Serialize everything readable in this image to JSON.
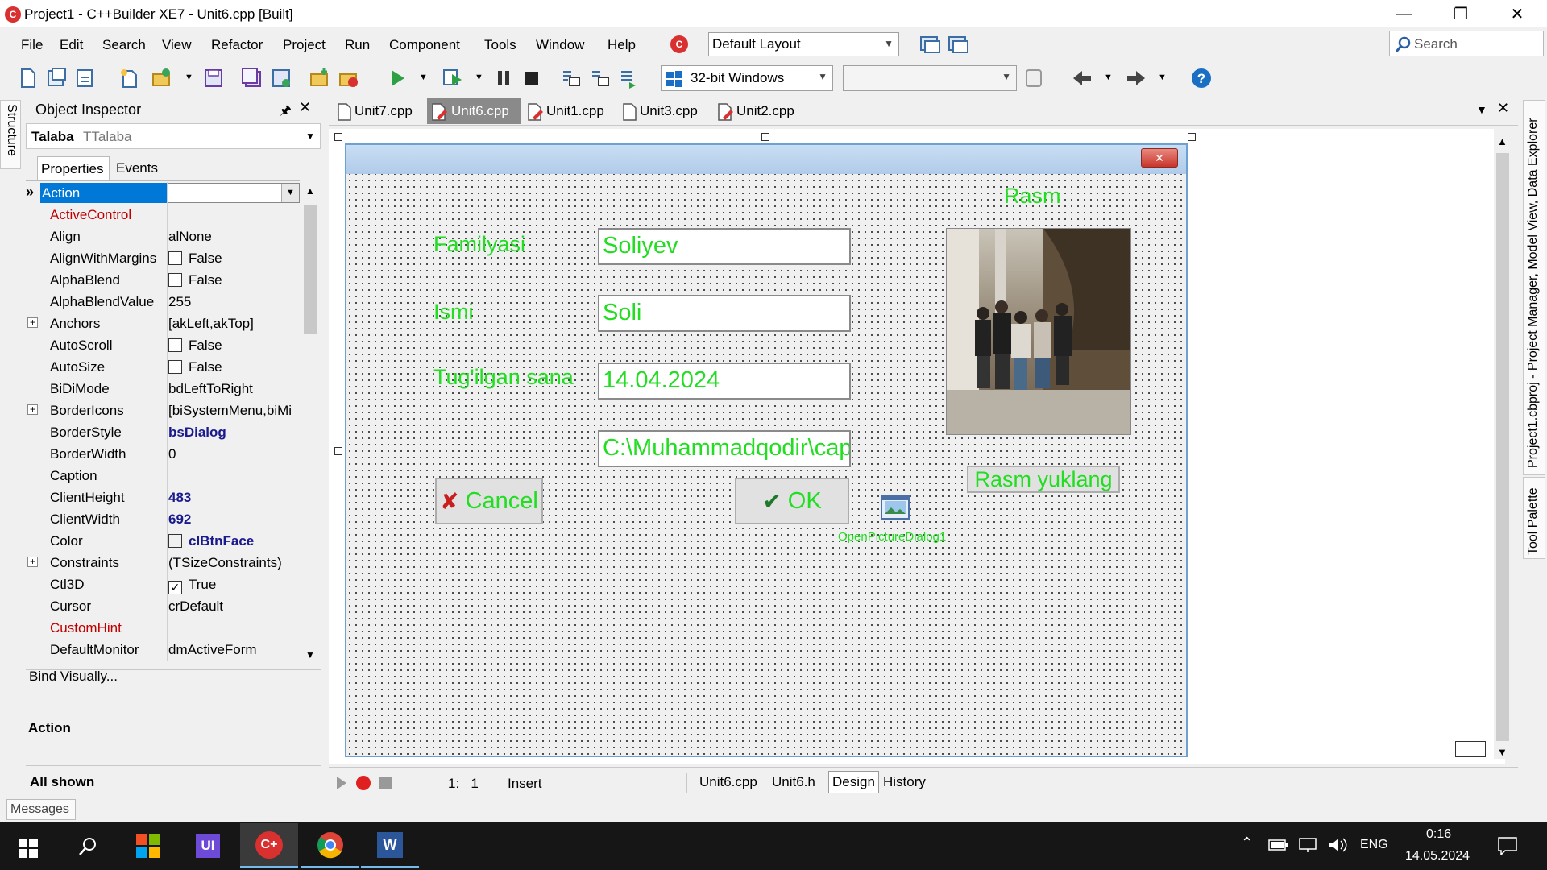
{
  "window": {
    "title": "Project1 - C++Builder XE7 - Unit6.cpp [Built]",
    "app_icon": "C"
  },
  "menu": [
    "File",
    "Edit",
    "Search",
    "View",
    "Refactor",
    "Project",
    "Run",
    "Component",
    "Tools",
    "Window",
    "Help"
  ],
  "toolbar": {
    "layout": "Default Layout",
    "search_placeholder": "Search",
    "platform": "32-bit Windows"
  },
  "structure_tab": "Structure",
  "object_inspector": {
    "title": "Object Inspector",
    "object_name": "Talaba",
    "object_type": "TTalaba",
    "tabs": [
      "Properties",
      "Events"
    ],
    "properties": [
      {
        "name": "Action",
        "value": "",
        "selected": true
      },
      {
        "name": "ActiveControl",
        "value": "",
        "color": "#c00000"
      },
      {
        "name": "Align",
        "value": "alNone"
      },
      {
        "name": "AlignWithMargins",
        "value": "False",
        "checkbox": true
      },
      {
        "name": "AlphaBlend",
        "value": "False",
        "checkbox": true
      },
      {
        "name": "AlphaBlendValue",
        "value": "255"
      },
      {
        "name": "Anchors",
        "value": "[akLeft,akTop]",
        "expand": true
      },
      {
        "name": "AutoScroll",
        "value": "False",
        "checkbox": true
      },
      {
        "name": "AutoSize",
        "value": "False",
        "checkbox": true
      },
      {
        "name": "BiDiMode",
        "value": "bdLeftToRight"
      },
      {
        "name": "BorderIcons",
        "value": "[biSystemMenu,biMi",
        "expand": true
      },
      {
        "name": "BorderStyle",
        "value": "bsDialog",
        "bold": true
      },
      {
        "name": "BorderWidth",
        "value": "0"
      },
      {
        "name": "Caption",
        "value": ""
      },
      {
        "name": "ClientHeight",
        "value": "483",
        "bold": true
      },
      {
        "name": "ClientWidth",
        "value": "692",
        "bold": true
      },
      {
        "name": "Color",
        "value": "clBtnFace",
        "bold": true,
        "swatch": true
      },
      {
        "name": "Constraints",
        "value": "(TSizeConstraints)",
        "expand": true
      },
      {
        "name": "Ctl3D",
        "value": "True",
        "checkbox": true,
        "checked": true
      },
      {
        "name": "Cursor",
        "value": "crDefault"
      },
      {
        "name": "CustomHint",
        "value": "",
        "color": "#c00000"
      },
      {
        "name": "DefaultMonitor",
        "value": "dmActiveForm"
      }
    ],
    "bind_visually": "Bind Visually...",
    "footer_title": "Action",
    "footer_status": "All shown"
  },
  "editor_tabs": [
    {
      "label": "Unit7.cpp",
      "active": false
    },
    {
      "label": "Unit6.cpp",
      "active": true
    },
    {
      "label": "Unit1.cpp",
      "active": false
    },
    {
      "label": "Unit3.cpp",
      "active": false
    },
    {
      "label": "Unit2.cpp",
      "active": false
    }
  ],
  "form": {
    "labels": {
      "rasm": "Rasm",
      "familiyasi": "Familyasi",
      "ismi": "Ismi",
      "tugilgan_sana": "Tug'ilgan sana"
    },
    "fields": {
      "familiyasi": "Soliyev",
      "ismi": "Soli",
      "sana": "14.04.2024",
      "path": "C:\\Muhammadqodir\\cap"
    },
    "buttons": {
      "cancel": "Cancel",
      "ok": "OK",
      "upload": "Rasm yuklang"
    },
    "dialog_component": "OpenPictureDialog1"
  },
  "right_side_tabs": {
    "top": "Project1.cbproj - Project Manager, Model View, Data Explorer",
    "bottom": "Tool Palette"
  },
  "status_bar": {
    "position": "1:   1",
    "mode": "Insert",
    "view_tabs": [
      "Unit6.cpp",
      "Unit6.h",
      "Design",
      "History"
    ],
    "active_view": "Design"
  },
  "messages_tab": "Messages",
  "taskbar": {
    "language": "ENG",
    "time": "0:16",
    "date": "14.05.2024"
  },
  "colors": {
    "accent_green": "#22dd22",
    "selection": "#0078d7",
    "bold_value": "#1a1a8c",
    "red_property": "#c00000"
  }
}
